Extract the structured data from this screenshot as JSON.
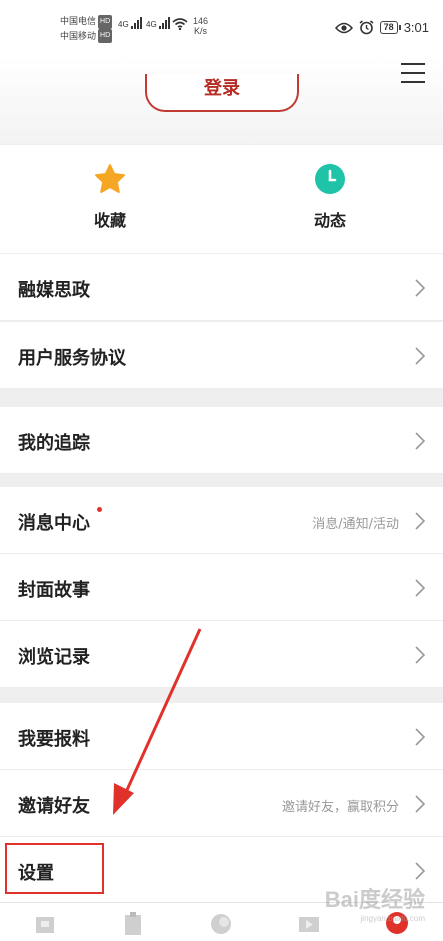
{
  "status_bar": {
    "carrier1": "中国电信",
    "carrier2": "中国移动",
    "hd": "HD",
    "net1": "4G",
    "net2": "4G",
    "speed_value": "146",
    "speed_unit": "K/s",
    "battery": "78",
    "time": "3:01"
  },
  "header": {
    "login_label": "登录"
  },
  "quick_actions": [
    {
      "label": "收藏",
      "icon": "star-icon",
      "color": "#f5a623"
    },
    {
      "label": "动态",
      "icon": "clock-icon",
      "color": "#1fc3a8"
    }
  ],
  "menu": {
    "group1": [
      {
        "title": "融媒思政",
        "subtitle": ""
      },
      {
        "title": "用户服务协议",
        "subtitle": ""
      }
    ],
    "group2": [
      {
        "title": "我的追踪",
        "subtitle": ""
      },
      {
        "title": "消息中心",
        "subtitle": "消息/通知/活动"
      },
      {
        "title": "封面故事",
        "subtitle": ""
      },
      {
        "title": "浏览记录",
        "subtitle": ""
      }
    ],
    "group3": [
      {
        "title": "我要报料",
        "subtitle": ""
      },
      {
        "title": "邀请好友",
        "subtitle": "邀请好友，赢取积分"
      },
      {
        "title": "设置",
        "subtitle": ""
      }
    ]
  },
  "watermark": {
    "text": "Bai度经验",
    "url": "jingyan.baidu.com"
  },
  "colors": {
    "accent": "#c23b33",
    "annotation": "#e0322b"
  }
}
